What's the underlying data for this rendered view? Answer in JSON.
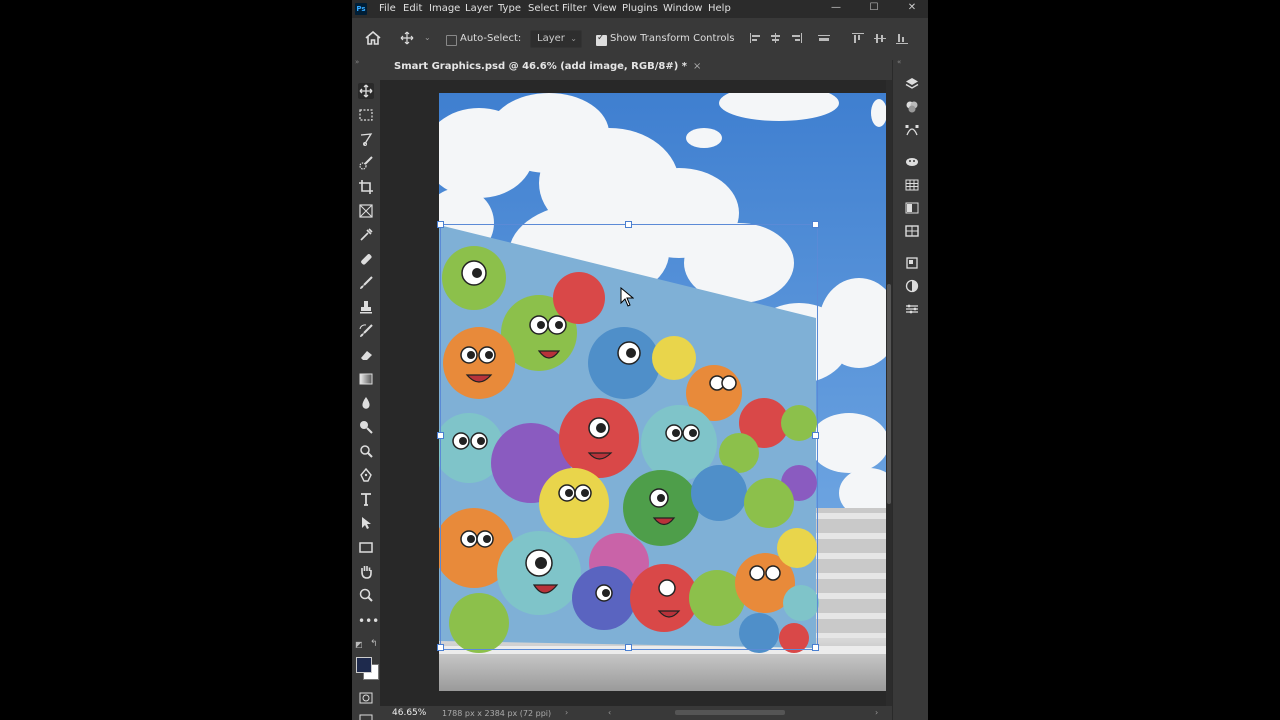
{
  "app": {
    "logo": "Ps",
    "menu": [
      "File",
      "Edit",
      "Image",
      "Layer",
      "Type",
      "Select",
      "Filter",
      "View",
      "Plugins",
      "Window",
      "Help"
    ],
    "window_controls": [
      "—",
      "☐",
      "✕"
    ]
  },
  "options_bar": {
    "auto_select_label": "Auto-Select:",
    "auto_select_checked": false,
    "target_value": "Layer",
    "show_transform_label": "Show Transform Controls",
    "show_transform_checked": true
  },
  "document": {
    "tab_title": "Smart Graphics.psd @ 46.6% (add image, RGB/8#) *",
    "tab_close": "×"
  },
  "status": {
    "zoom": "46.65%",
    "dimensions": "1788 px x 2384 px (72 ppi)"
  },
  "colors": {
    "foreground": "#1e2a4d",
    "background": "#ffffff",
    "accent": "#31a8ff",
    "transform_box": "#5b8ad6"
  },
  "icons": {
    "left_tools": [
      "move-icon",
      "marquee-icon",
      "lasso-icon",
      "quick-select-icon",
      "crop-icon",
      "frame-icon",
      "eyedropper-icon",
      "healing-brush-icon",
      "brush-icon",
      "stamp-icon",
      "history-brush-icon",
      "eraser-icon",
      "gradient-icon",
      "blur-icon",
      "dodge-icon",
      "pen-icon",
      "type-icon",
      "path-select-icon",
      "rectangle-icon",
      "hand-icon",
      "zoom-icon",
      "more-tools-icon"
    ],
    "right_panels": [
      "layers-icon",
      "channels-icon",
      "paths-icon",
      "color-icon",
      "swatches-icon",
      "gradients-icon",
      "patterns-icon",
      "properties-icon",
      "adjustments-icon",
      "libraries-icon"
    ]
  }
}
